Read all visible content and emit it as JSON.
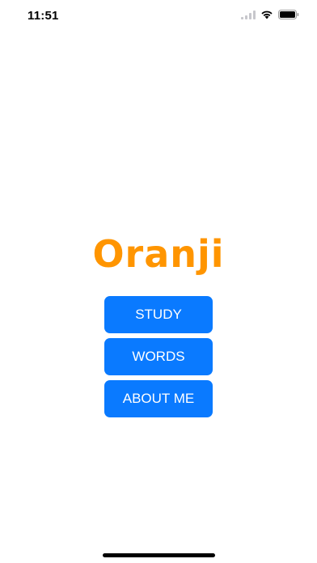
{
  "status_bar": {
    "time": "11:51",
    "icons": [
      "signal-icon",
      "wifi-icon",
      "battery-icon"
    ]
  },
  "app": {
    "title": "Oranji",
    "title_color": "#FF9500"
  },
  "menu": {
    "button_color": "#0A7AFF",
    "buttons": [
      {
        "label": "STUDY"
      },
      {
        "label": "WORDS"
      },
      {
        "label": "ABOUT ME"
      }
    ]
  }
}
